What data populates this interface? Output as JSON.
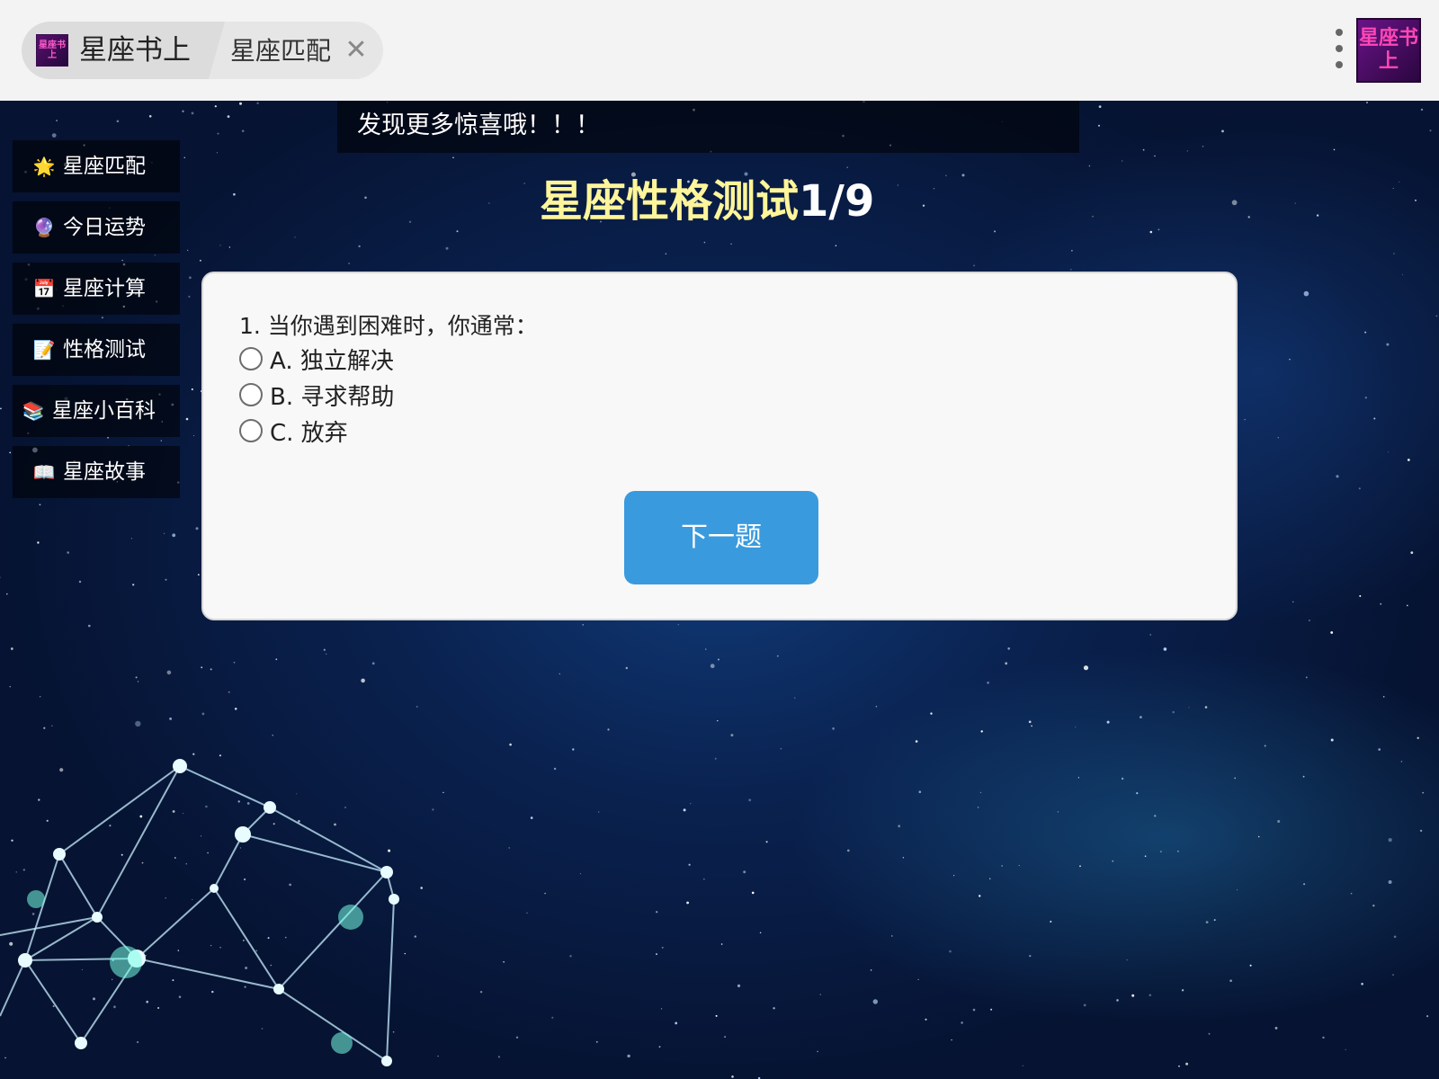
{
  "browser": {
    "home_tab_label": "星座书上",
    "active_tab_label": "星座匹配",
    "close_glyph": "✕",
    "mini_logo_text": "星座书上",
    "app_logo_text": "星座书上"
  },
  "marquee": {
    "text": "发现更多惊喜哦！！！"
  },
  "sidebar": {
    "items": [
      {
        "icon": "🌟",
        "icon_name": "star-icon",
        "label": "星座匹配"
      },
      {
        "icon": "🔮",
        "icon_name": "crystal-ball-icon",
        "label": "今日运势"
      },
      {
        "icon": "📅",
        "icon_name": "calendar-icon",
        "label": "星座计算"
      },
      {
        "icon": "📝",
        "icon_name": "memo-icon",
        "label": "性格测试"
      },
      {
        "icon": "📚",
        "icon_name": "books-icon",
        "label": "星座小百科"
      },
      {
        "icon": "📖",
        "icon_name": "open-book-icon",
        "label": "星座故事"
      }
    ]
  },
  "quiz": {
    "title": "星座性格测试",
    "progress": "1/9",
    "question": "1. 当你遇到困难时，你通常：",
    "options": [
      "A. 独立解决",
      "B. 寻求帮助",
      "C. 放弃"
    ],
    "next_label": "下一题"
  },
  "colors": {
    "title_accent": "#fff59a",
    "button": "#3a9ade",
    "card_bg": "#f8f8f8",
    "space_dark": "#061332"
  }
}
